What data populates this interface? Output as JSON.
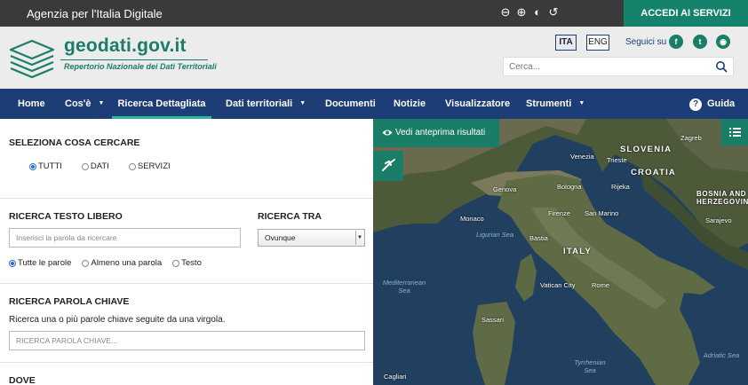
{
  "topbar": {
    "agency": "Agenzia per l'Italia Digitale",
    "access_button": "ACCEDI AI SERVIZI",
    "tools": [
      {
        "icon": "zoom-out-icon",
        "glyph": "⊖"
      },
      {
        "icon": "zoom-in-icon",
        "glyph": "⊕"
      },
      {
        "icon": "contrast-icon",
        "glyph": "◐"
      },
      {
        "icon": "reset-icon",
        "glyph": "↺"
      }
    ]
  },
  "header": {
    "brand": "geodati.gov.it",
    "brand_sub": "Repertorio Nazionale dei Dati Territoriali",
    "lang_ita": "ITA",
    "lang_eng": "ENG",
    "follow_label": "Seguici su",
    "social": [
      {
        "icon": "facebook-icon",
        "glyph": "f"
      },
      {
        "icon": "twitter-icon",
        "glyph": "t"
      },
      {
        "icon": "rss-icon",
        "glyph": "◉"
      }
    ],
    "search_placeholder": "Cerca..."
  },
  "nav": {
    "items": [
      {
        "label": "Home"
      },
      {
        "label": "Cos'è"
      },
      {
        "label": "Ricerca Dettagliata"
      },
      {
        "label": "Dati territoriali"
      },
      {
        "label": "Documenti"
      },
      {
        "label": "Notizie"
      },
      {
        "label": "Visualizzatore"
      },
      {
        "label": "Strumenti"
      }
    ],
    "guida": "Guida",
    "active_index": 2
  },
  "search_panel": {
    "what_title": "SELEZIONA COSA CERCARE",
    "what_options": [
      "TUTTI",
      "DATI",
      "SERVIZI"
    ],
    "free_text_title": "RICERCA TESTO LIBERO",
    "free_text_placeholder": "Inserisci la parola da ricercare",
    "search_in_title": "RICERCA TRA",
    "search_in_value": "Ovunque",
    "match_options": [
      "Tutte le parole",
      "Almeno una parola",
      "Testo"
    ],
    "keyword_title": "RICERCA PAROLA CHIAVE",
    "keyword_help": "Ricerca una o più parole chiave seguite da una virgola.",
    "keyword_placeholder": "RICERCA PAROLA CHIAVE...",
    "where_title": "DOVE"
  },
  "map": {
    "preview_button": "Vedi anteprima risultati",
    "labels": {
      "slovenia": "SLOVENIA",
      "zagreb": "Zagreb",
      "venezia": "Venezia",
      "trieste": "Trieste",
      "croatia": "CROATIA",
      "genova": "Genova",
      "bologna": "Bologna",
      "rijeka": "Rijeka",
      "monaco": "Monaco",
      "firenze": "Firenze",
      "san_marino": "San Marino",
      "ligurian_sea": "Ligurian Sea",
      "bastia": "Bastia",
      "bosnia": "BOSNIA AND HERZEGOVINA",
      "sarajevo": "Sarajevo",
      "italy": "ITALY",
      "mediterranean": "Mediterranean Sea",
      "vatican": "Vatican City",
      "rome": "Rome",
      "sassari": "Sassari",
      "tyrrhenian": "Tyrrhenian Sea",
      "cagliari": "Cagliari",
      "adriatic": "Adriatic Sea"
    }
  }
}
